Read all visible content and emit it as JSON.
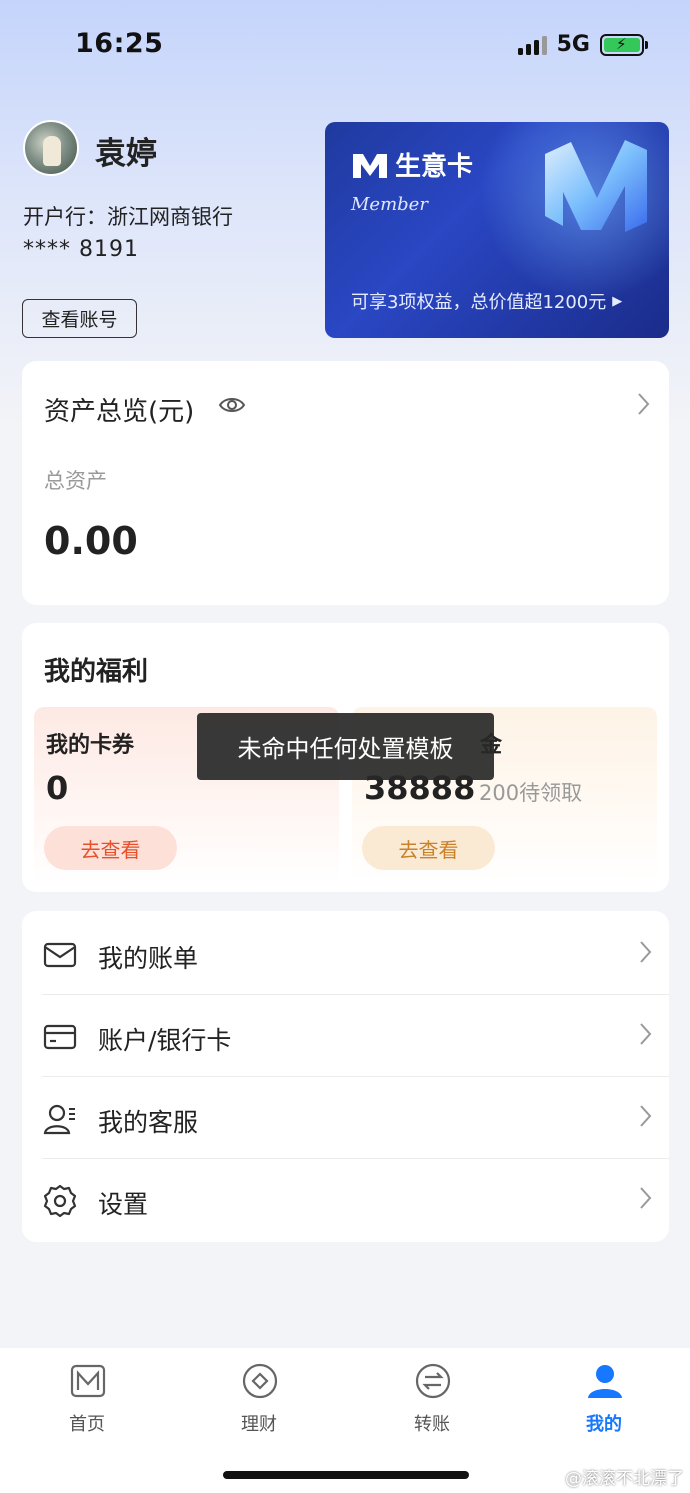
{
  "status_bar": {
    "time": "16:25",
    "network": "5G"
  },
  "profile": {
    "name": "袁婷",
    "bank_line": "开户行：浙江网商银行",
    "account_masked": "**** 8191",
    "view_account_label": "查看账号"
  },
  "member_card": {
    "title": "生意卡",
    "subtitle": "Member",
    "description": "可享3项权益，总价值超1200元",
    "accent_color": "#2a47c4"
  },
  "assets": {
    "title": "资产总览(元)",
    "total_label": "总资产",
    "total_value": "0.00"
  },
  "welfare": {
    "title": "我的福利",
    "coupons": {
      "label": "我的卡券",
      "value": "0",
      "button": "去查看"
    },
    "gold": {
      "label": "金",
      "value": "38888",
      "sub": "200待领取",
      "button": "去查看"
    }
  },
  "toast": {
    "text": "未命中任何处置模板"
  },
  "menu": {
    "items": [
      {
        "label": "我的账单",
        "icon": "mail-icon"
      },
      {
        "label": "账户/银行卡",
        "icon": "card-icon"
      },
      {
        "label": "我的客服",
        "icon": "customer-service-icon"
      },
      {
        "label": "设置",
        "icon": "gear-icon"
      }
    ]
  },
  "bottom_nav": {
    "items": [
      {
        "label": "首页",
        "icon": "home-icon"
      },
      {
        "label": "理财",
        "icon": "wealth-icon"
      },
      {
        "label": "转账",
        "icon": "transfer-icon"
      },
      {
        "label": "我的",
        "icon": "user-icon"
      }
    ],
    "active_index": 3,
    "active_color": "#1677ff"
  },
  "watermark": "@滚滚不北漂了"
}
